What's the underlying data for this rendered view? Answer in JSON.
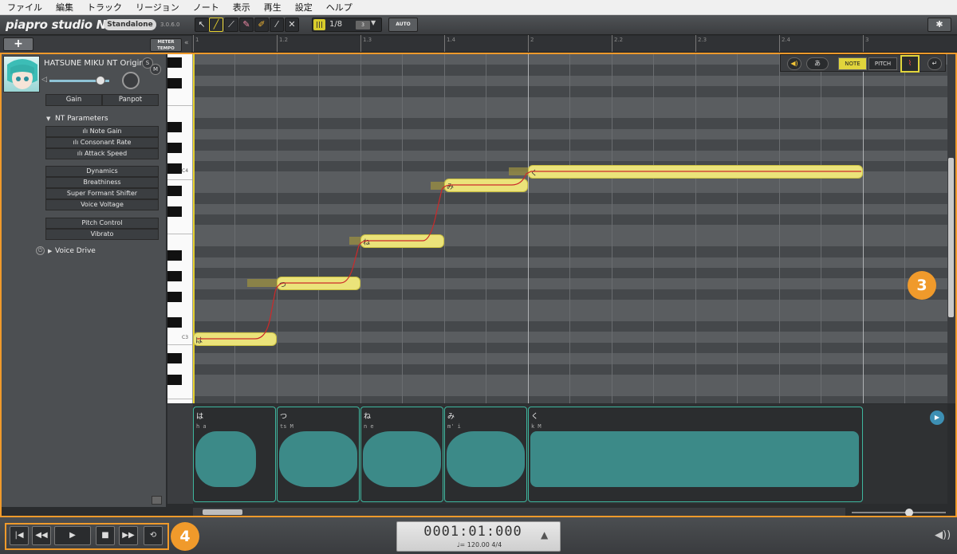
{
  "menu": [
    "ファイル",
    "編集",
    "トラック",
    "リージョン",
    "ノート",
    "表示",
    "再生",
    "設定",
    "ヘルプ"
  ],
  "toolbar": {
    "logo": "piapro studio NT",
    "mode_badge": "Standalone",
    "version": "3.0.6.0",
    "tools": [
      {
        "name": "select-tool",
        "glyph": "↖"
      },
      {
        "name": "pencil-tool",
        "glyph": "╱"
      },
      {
        "name": "line-tool",
        "glyph": "⟋"
      },
      {
        "name": "eraser-tool",
        "glyph": "✎"
      },
      {
        "name": "brush-tool",
        "glyph": "✐"
      },
      {
        "name": "knife-tool",
        "glyph": "⁄"
      },
      {
        "name": "mute-tool",
        "glyph": "✕"
      }
    ],
    "quantize_value": "1/8",
    "triplet_label": "3",
    "auto_label": "AUTO",
    "settings_glyph": "✱"
  },
  "track_strip": {
    "add_label": "+",
    "meter_tempo": "METER TEMPO",
    "collapse_glyph": "«"
  },
  "ruler": [
    "1",
    "1.2",
    "1.3",
    "1.4",
    "2",
    "2.2",
    "2.3",
    "2.4",
    "3"
  ],
  "track": {
    "name": "HATSUNE MIKU NT Original",
    "solo": "S",
    "mute": "M",
    "gain": "Gain",
    "panpot": "Panpot",
    "nt_parameters": "NT Parameters",
    "nt_params": [
      "Note Gain",
      "Consonant Rate",
      "Attack Speed"
    ],
    "group2": [
      "Dynamics",
      "Breathiness",
      "Super Formant Shifter",
      "Voice Voltage"
    ],
    "group3": [
      "Pitch Control",
      "Vibrato"
    ],
    "voice_drive": "Voice Drive",
    "power_glyph": "⏻"
  },
  "keyboard": {
    "c4": "C4",
    "c3": "C3"
  },
  "notes": [
    {
      "lyric": "は",
      "phoneme": "h a"
    },
    {
      "lyric": "つ",
      "phoneme": "ts M"
    },
    {
      "lyric": "ね",
      "phoneme": "n e"
    },
    {
      "lyric": "み",
      "phoneme": "m' i"
    },
    {
      "lyric": "く",
      "phoneme": "k M"
    }
  ],
  "roll_tools": {
    "speaker_glyph": "◀)",
    "lyric_glyph": "あ",
    "note": "NOTE",
    "pitch": "PITCH",
    "pitch_curve_glyph": "⌇",
    "return_glyph": "↵"
  },
  "callouts": {
    "three": "3",
    "four": "4"
  },
  "transport": {
    "buttons": [
      {
        "name": "go-to-start-button",
        "glyph": "|◀"
      },
      {
        "name": "rewind-button",
        "glyph": "◀◀"
      },
      {
        "name": "play-button",
        "glyph": "▶"
      },
      {
        "name": "stop-button",
        "glyph": "■"
      },
      {
        "name": "fast-forward-button",
        "glyph": "▶▶"
      },
      {
        "name": "loop-button",
        "glyph": "⟲"
      }
    ],
    "time": "0001:01:000",
    "tempo": "♩= 120.00   4/4",
    "metronome_glyph": "▲",
    "volume_glyph": "◀))"
  },
  "wave_play_glyph": "▶",
  "colors": {
    "accent": "#f09a2b",
    "note": "#ebe37a",
    "wave": "#3eb69e",
    "pitch_curve": "#cc2a2a"
  }
}
